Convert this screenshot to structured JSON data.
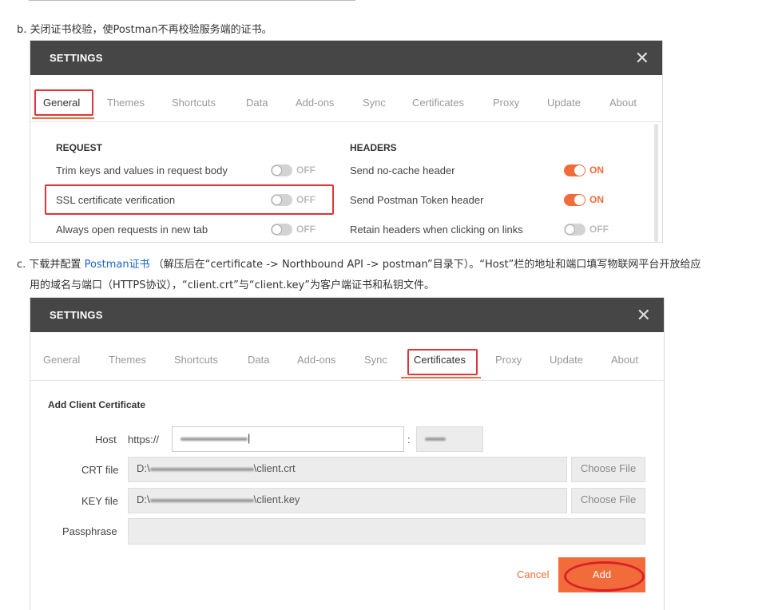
{
  "step_b": {
    "prefix": "b. ",
    "text": "关闭证书校验，使Postman不再校验服务端的证书。"
  },
  "step_c": {
    "prefix": "c. ",
    "text_before": "下载并配置 ",
    "link": "Postman证书",
    "text_after": " （解压后在“certificate -> Northbound API -> postman”目录下）。“Host”栏的地址和端口填写物联网平台开放给应",
    "line2": "用的域名与端口（HTTPS协议），“client.crt”与“client.key”为客户端证书和私钥文件。"
  },
  "dialog1": {
    "title": "SETTINGS",
    "close": "✕",
    "tabs": [
      "General",
      "Themes",
      "Shortcuts",
      "Data",
      "Add-ons",
      "Sync",
      "Certificates",
      "Proxy",
      "Update",
      "About"
    ],
    "active_tab": "General",
    "request": {
      "heading": "REQUEST",
      "rows": [
        {
          "label": "Trim keys and values in request body",
          "state": "OFF"
        },
        {
          "label": "SSL certificate verification",
          "state": "OFF"
        },
        {
          "label": "Always open requests in new tab",
          "state": "OFF"
        }
      ]
    },
    "headers": {
      "heading": "HEADERS",
      "rows": [
        {
          "label": "Send no-cache header",
          "state": "ON"
        },
        {
          "label": "Send Postman Token header",
          "state": "ON"
        },
        {
          "label": "Retain headers when clicking on links",
          "state": "OFF"
        }
      ]
    }
  },
  "dialog2": {
    "title": "SETTINGS",
    "close": "✕",
    "tabs": [
      "General",
      "Themes",
      "Shortcuts",
      "Data",
      "Add-ons",
      "Sync",
      "Certificates",
      "Proxy",
      "Update",
      "About"
    ],
    "active_tab": "Certificates",
    "section": "Add Client Certificate",
    "host_label": "Host",
    "host_prefix": "https://",
    "port_sep": ":",
    "crt_label": "CRT file",
    "crt_prefix": "D:\\",
    "crt_suffix": "\\client.crt",
    "key_label": "KEY file",
    "key_prefix": "D:\\",
    "key_suffix": "\\client.key",
    "passphrase_label": "Passphrase",
    "choose_file": "Choose File",
    "cancel": "Cancel",
    "add": "Add"
  },
  "colors": {
    "accent": "#f26b3a",
    "header_bg": "#464646",
    "highlight_red": "#e0343a",
    "link": "#1a66c9"
  }
}
